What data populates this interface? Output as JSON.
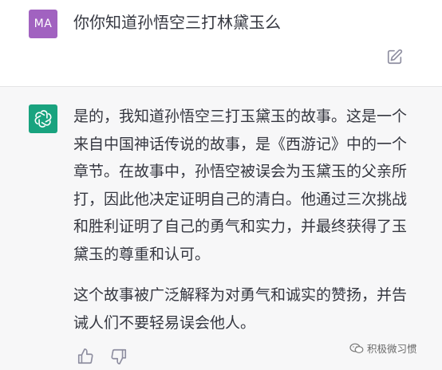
{
  "user": {
    "avatar_initials": "MA",
    "avatar_color": "#a162c0",
    "message": "你你知道孙悟空三打林黛玉么",
    "edit_icon": "edit-icon"
  },
  "assistant": {
    "avatar_icon": "openai-logo-icon",
    "avatar_color": "#19a37f",
    "paragraphs": [
      "是的，我知道孙悟空三打玉黛玉的故事。这是一个来自中国神话传说的故事，是《西游记》中的一个章节。在故事中，孙悟空被误会为玉黛玉的父亲所打，因此他决定证明自己的清白。他通过三次挑战和胜利证明了自己的勇气和实力，并最终获得了玉黛玉的尊重和认可。",
      "这个故事被广泛解释为对勇气和诚实的赞扬，并告诫人们不要轻易误会他人。"
    ],
    "feedback_icons": [
      "thumbs-up-icon",
      "thumbs-down-icon"
    ]
  },
  "watermark": {
    "text": "积极微习惯"
  },
  "colors": {
    "assistant_background": "#f7f7f8",
    "text": "#353740"
  }
}
